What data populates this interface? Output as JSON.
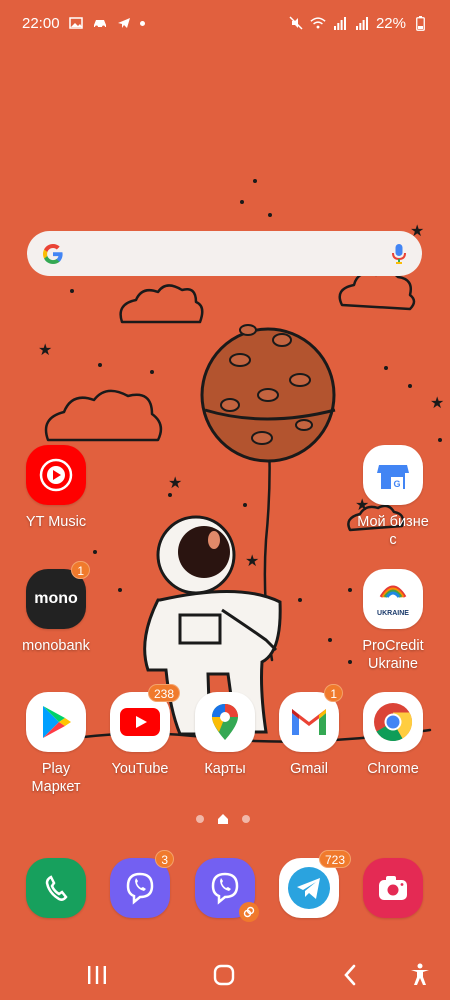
{
  "status_bar": {
    "time": "22:00",
    "battery": "22%",
    "left_icons": [
      "image-icon",
      "car-icon",
      "telegram-status-icon",
      "dot-icon"
    ],
    "right_icons": [
      "mute-icon",
      "wifi-icon",
      "signal-icon",
      "signal-icon",
      "battery-icon"
    ]
  },
  "search": {
    "placeholder": "",
    "icons": [
      "google-g-icon",
      "microphone-icon"
    ]
  },
  "apps": [
    {
      "label": "YT Music",
      "icon": "yt-music-icon",
      "badge": ""
    },
    {
      "label": "Мой бизне\nс",
      "icon": "google-business-icon",
      "badge": ""
    },
    {
      "label": "monobank",
      "icon": "monobank-icon",
      "icon_text": "mono",
      "badge": "1"
    },
    {
      "label": "ProCredit\nUkraine",
      "icon": "procredit-icon",
      "icon_text": "UKRAINE",
      "badge": ""
    },
    {
      "label": "Play\nМаркет",
      "icon": "play-store-icon",
      "badge": ""
    },
    {
      "label": "YouTube",
      "icon": "youtube-icon",
      "badge": "238"
    },
    {
      "label": "Карты",
      "icon": "maps-icon",
      "badge": ""
    },
    {
      "label": "Gmail",
      "icon": "gmail-icon",
      "badge": "1"
    },
    {
      "label": "Chrome",
      "icon": "chrome-icon",
      "badge": ""
    }
  ],
  "dock": [
    {
      "icon": "phone-icon",
      "badge": ""
    },
    {
      "icon": "viber-icon",
      "badge": "3"
    },
    {
      "icon": "viber-clone-icon",
      "badge": ""
    },
    {
      "icon": "telegram-icon",
      "badge": "723"
    },
    {
      "icon": "camera-icon",
      "badge": ""
    }
  ],
  "page_indicator": {
    "pages": 3,
    "current": 1
  },
  "nav": [
    "recents-icon",
    "home-icon",
    "back-icon",
    "accessibility-icon"
  ],
  "colors": {
    "wallpaper": "#e1603e",
    "badge": "#f07a2c",
    "search_bg": "#f4f0ee"
  }
}
